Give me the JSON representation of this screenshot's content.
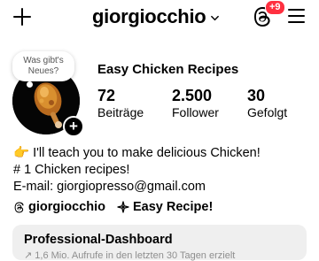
{
  "header": {
    "username": "giorgiocchio",
    "notification_count": "+9",
    "add_icon": "plus-icon",
    "menu_icon": "hamburger-menu-icon",
    "threads_icon": "threads-icon"
  },
  "profile": {
    "note": "Was gibt's Neues?",
    "display_name": "Easy Chicken Recipes",
    "stats": [
      {
        "value": "72",
        "label": "Beiträge"
      },
      {
        "value": "2.500",
        "label": "Follower"
      },
      {
        "value": "30",
        "label": "Gefolgt"
      }
    ],
    "bio": [
      "👉 I'll teach you to make delicious Chicken!",
      "# 1 Chicken recipes!",
      "E-mail: giorgiopresso@gmail.com"
    ],
    "links": [
      {
        "icon": "threads-icon",
        "text": "giorgiocchio"
      },
      {
        "icon": "chef-kiss-icon",
        "text": "Easy Recipe!"
      }
    ]
  },
  "dashboard": {
    "title": "Professional-Dashboard",
    "subtitle": "↗ 1,6 Mio. Aufrufe in den letzten 30 Tagen erzielt"
  }
}
